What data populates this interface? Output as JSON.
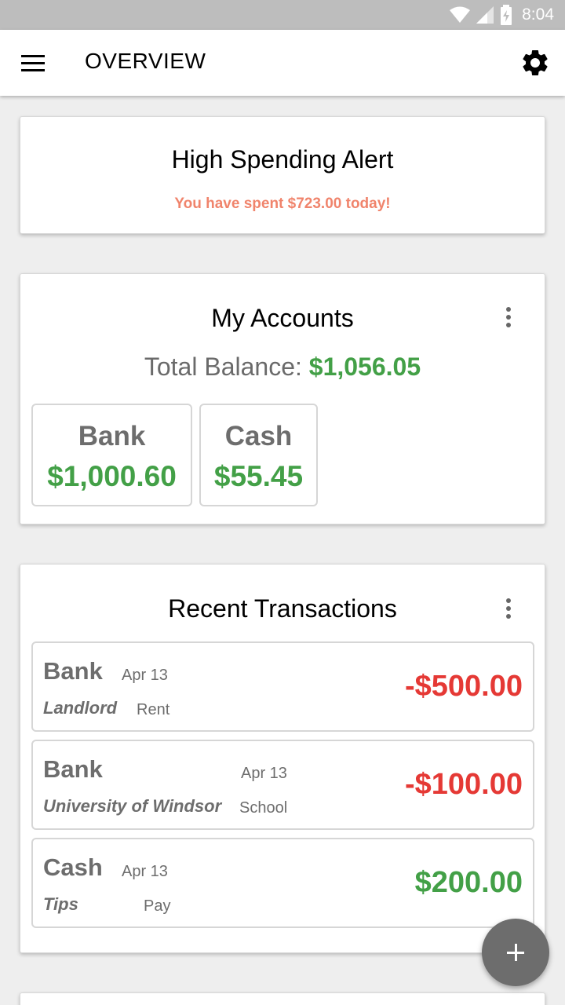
{
  "status_bar": {
    "time": "8:04"
  },
  "app_bar": {
    "title": "OVERVIEW"
  },
  "alert": {
    "title": "High Spending Alert",
    "message": "You have spent $723.00 today!"
  },
  "accounts": {
    "title": "My Accounts",
    "total_label": "Total Balance: ",
    "total_value": "$1,056.05",
    "items": [
      {
        "name": "Bank",
        "balance": "$1,000.60"
      },
      {
        "name": "Cash",
        "balance": "$55.45"
      }
    ]
  },
  "transactions": {
    "title": "Recent Transactions",
    "items": [
      {
        "account": "Bank",
        "date": "Apr 13",
        "payee": "Landlord",
        "category": "Rent",
        "amount": "-$500.00",
        "type": "expense"
      },
      {
        "account": "Bank",
        "date": "Apr 13",
        "payee": "University of Windsor",
        "category": "School",
        "amount": "-$100.00",
        "type": "expense"
      },
      {
        "account": "Cash",
        "date": "Apr 13",
        "payee": "Tips",
        "category": "Pay",
        "amount": "$200.00",
        "type": "income"
      }
    ]
  },
  "colors": {
    "positive": "#43a047",
    "negative": "#e53935",
    "alert": "#f0846c",
    "fab": "#6d6d6d"
  },
  "icons": {
    "menu": "menu-icon",
    "settings": "gear-icon",
    "overflow": "more-vert-icon",
    "add": "plus-icon",
    "wifi": "wifi-icon",
    "signal": "signal-icon",
    "battery": "battery-charging-icon"
  }
}
